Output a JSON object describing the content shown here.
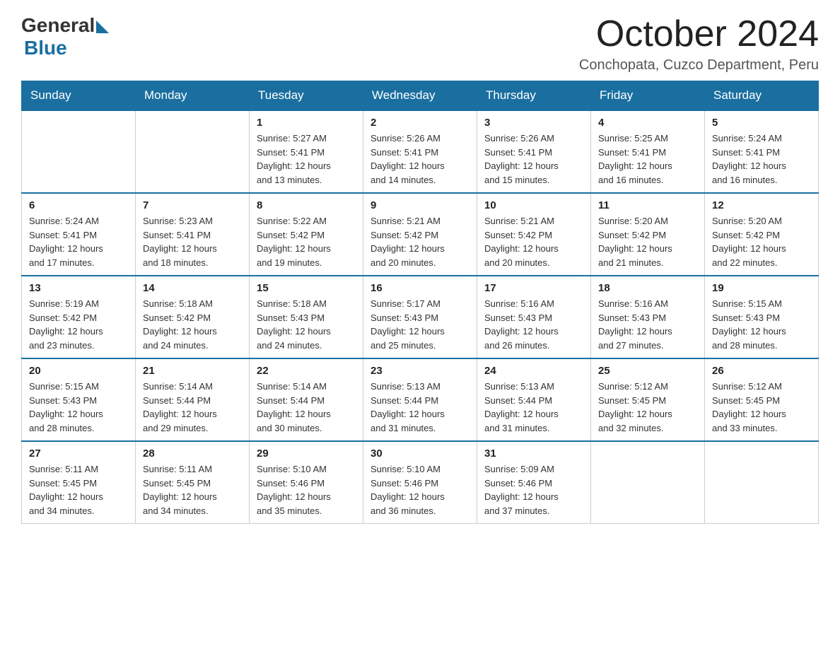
{
  "header": {
    "logo_general": "General",
    "logo_blue": "Blue",
    "month_title": "October 2024",
    "location": "Conchopata, Cuzco Department, Peru"
  },
  "weekdays": [
    "Sunday",
    "Monday",
    "Tuesday",
    "Wednesday",
    "Thursday",
    "Friday",
    "Saturday"
  ],
  "weeks": [
    [
      {
        "day": "",
        "detail": ""
      },
      {
        "day": "",
        "detail": ""
      },
      {
        "day": "1",
        "detail": "Sunrise: 5:27 AM\nSunset: 5:41 PM\nDaylight: 12 hours\nand 13 minutes."
      },
      {
        "day": "2",
        "detail": "Sunrise: 5:26 AM\nSunset: 5:41 PM\nDaylight: 12 hours\nand 14 minutes."
      },
      {
        "day": "3",
        "detail": "Sunrise: 5:26 AM\nSunset: 5:41 PM\nDaylight: 12 hours\nand 15 minutes."
      },
      {
        "day": "4",
        "detail": "Sunrise: 5:25 AM\nSunset: 5:41 PM\nDaylight: 12 hours\nand 16 minutes."
      },
      {
        "day": "5",
        "detail": "Sunrise: 5:24 AM\nSunset: 5:41 PM\nDaylight: 12 hours\nand 16 minutes."
      }
    ],
    [
      {
        "day": "6",
        "detail": "Sunrise: 5:24 AM\nSunset: 5:41 PM\nDaylight: 12 hours\nand 17 minutes."
      },
      {
        "day": "7",
        "detail": "Sunrise: 5:23 AM\nSunset: 5:41 PM\nDaylight: 12 hours\nand 18 minutes."
      },
      {
        "day": "8",
        "detail": "Sunrise: 5:22 AM\nSunset: 5:42 PM\nDaylight: 12 hours\nand 19 minutes."
      },
      {
        "day": "9",
        "detail": "Sunrise: 5:21 AM\nSunset: 5:42 PM\nDaylight: 12 hours\nand 20 minutes."
      },
      {
        "day": "10",
        "detail": "Sunrise: 5:21 AM\nSunset: 5:42 PM\nDaylight: 12 hours\nand 20 minutes."
      },
      {
        "day": "11",
        "detail": "Sunrise: 5:20 AM\nSunset: 5:42 PM\nDaylight: 12 hours\nand 21 minutes."
      },
      {
        "day": "12",
        "detail": "Sunrise: 5:20 AM\nSunset: 5:42 PM\nDaylight: 12 hours\nand 22 minutes."
      }
    ],
    [
      {
        "day": "13",
        "detail": "Sunrise: 5:19 AM\nSunset: 5:42 PM\nDaylight: 12 hours\nand 23 minutes."
      },
      {
        "day": "14",
        "detail": "Sunrise: 5:18 AM\nSunset: 5:42 PM\nDaylight: 12 hours\nand 24 minutes."
      },
      {
        "day": "15",
        "detail": "Sunrise: 5:18 AM\nSunset: 5:43 PM\nDaylight: 12 hours\nand 24 minutes."
      },
      {
        "day": "16",
        "detail": "Sunrise: 5:17 AM\nSunset: 5:43 PM\nDaylight: 12 hours\nand 25 minutes."
      },
      {
        "day": "17",
        "detail": "Sunrise: 5:16 AM\nSunset: 5:43 PM\nDaylight: 12 hours\nand 26 minutes."
      },
      {
        "day": "18",
        "detail": "Sunrise: 5:16 AM\nSunset: 5:43 PM\nDaylight: 12 hours\nand 27 minutes."
      },
      {
        "day": "19",
        "detail": "Sunrise: 5:15 AM\nSunset: 5:43 PM\nDaylight: 12 hours\nand 28 minutes."
      }
    ],
    [
      {
        "day": "20",
        "detail": "Sunrise: 5:15 AM\nSunset: 5:43 PM\nDaylight: 12 hours\nand 28 minutes."
      },
      {
        "day": "21",
        "detail": "Sunrise: 5:14 AM\nSunset: 5:44 PM\nDaylight: 12 hours\nand 29 minutes."
      },
      {
        "day": "22",
        "detail": "Sunrise: 5:14 AM\nSunset: 5:44 PM\nDaylight: 12 hours\nand 30 minutes."
      },
      {
        "day": "23",
        "detail": "Sunrise: 5:13 AM\nSunset: 5:44 PM\nDaylight: 12 hours\nand 31 minutes."
      },
      {
        "day": "24",
        "detail": "Sunrise: 5:13 AM\nSunset: 5:44 PM\nDaylight: 12 hours\nand 31 minutes."
      },
      {
        "day": "25",
        "detail": "Sunrise: 5:12 AM\nSunset: 5:45 PM\nDaylight: 12 hours\nand 32 minutes."
      },
      {
        "day": "26",
        "detail": "Sunrise: 5:12 AM\nSunset: 5:45 PM\nDaylight: 12 hours\nand 33 minutes."
      }
    ],
    [
      {
        "day": "27",
        "detail": "Sunrise: 5:11 AM\nSunset: 5:45 PM\nDaylight: 12 hours\nand 34 minutes."
      },
      {
        "day": "28",
        "detail": "Sunrise: 5:11 AM\nSunset: 5:45 PM\nDaylight: 12 hours\nand 34 minutes."
      },
      {
        "day": "29",
        "detail": "Sunrise: 5:10 AM\nSunset: 5:46 PM\nDaylight: 12 hours\nand 35 minutes."
      },
      {
        "day": "30",
        "detail": "Sunrise: 5:10 AM\nSunset: 5:46 PM\nDaylight: 12 hours\nand 36 minutes."
      },
      {
        "day": "31",
        "detail": "Sunrise: 5:09 AM\nSunset: 5:46 PM\nDaylight: 12 hours\nand 37 minutes."
      },
      {
        "day": "",
        "detail": ""
      },
      {
        "day": "",
        "detail": ""
      }
    ]
  ]
}
